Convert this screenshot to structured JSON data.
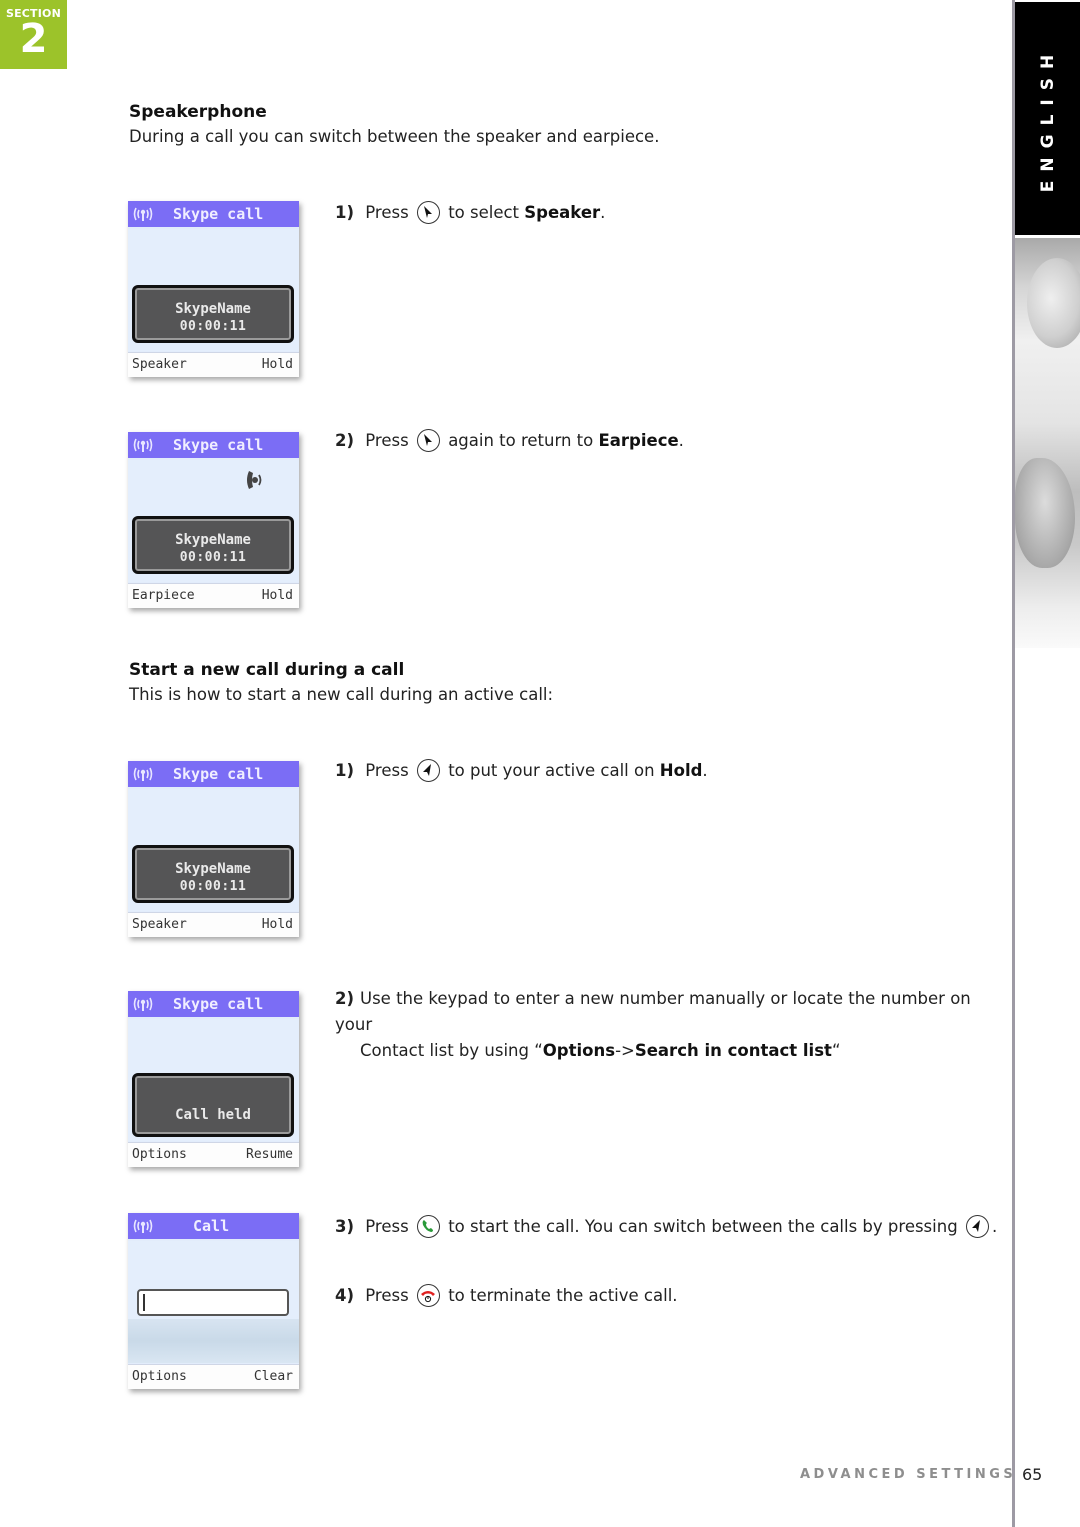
{
  "section": {
    "label": "SECTION",
    "number": "2",
    "color": "#9cc32a"
  },
  "language_tab": {
    "label": "ENGLISH"
  },
  "speakerphone": {
    "title": "Speakerphone",
    "intro": "During a call you can switch between the speaker and earpiece.",
    "steps": [
      {
        "num": "1)",
        "pre": "Press",
        "key_icon": "nav-down-right-icon",
        "post": "to select",
        "bold": "Speaker",
        "end": "."
      },
      {
        "num": "2)",
        "pre": "Press",
        "key_icon": "nav-down-right-icon",
        "post": "again to return to",
        "bold": "Earpiece",
        "end": "."
      }
    ],
    "screens": [
      {
        "title": "Skype call",
        "name": "SkypeName",
        "timer": "00:00:11",
        "left_soft": "Speaker",
        "right_soft": "Hold"
      },
      {
        "title": "Skype call",
        "name": "SkypeName",
        "timer": "00:00:11",
        "left_soft": "Earpiece",
        "right_soft": "Hold",
        "status_icon": "speaker-icon"
      }
    ]
  },
  "new_call": {
    "title": "Start a new call during a call",
    "intro": "This is how to start a new call during an active call:",
    "steps": [
      {
        "num": "1)",
        "pre": "Press",
        "key_icon": "nav-left-icon",
        "post": "to put your active call on",
        "bold": "Hold",
        "end": "."
      },
      {
        "num": "2)",
        "line1": "Use the keypad to enter a new number manually or locate the number on your",
        "line2_pre": "Contact list by using “",
        "bold1": "Options",
        "arrow": "->",
        "bold2": "Search in contact list",
        "line2_end": "“"
      },
      {
        "num": "3)",
        "pre": "Press",
        "key_icon": "call-green-icon",
        "post": "to start the call. You can switch between the calls by pressing",
        "key2_icon": "nav-left-icon",
        "end": "."
      },
      {
        "num": "4)",
        "pre": "Press",
        "key_icon": "end-call-red-icon",
        "post": "to terminate the active call."
      }
    ],
    "screens": [
      {
        "title": "Skype call",
        "name": "SkypeName",
        "timer": "00:00:11",
        "left_soft": "Speaker",
        "right_soft": "Hold"
      },
      {
        "title": "Skype call",
        "status": "Call held",
        "left_soft": "Options",
        "right_soft": "Resume"
      },
      {
        "title": "Call",
        "input_value": "",
        "left_soft": "Options",
        "right_soft": "Clear"
      }
    ]
  },
  "footer": {
    "section_name": "ADVANCED SETTINGS",
    "page_number": "65"
  },
  "colors": {
    "phone_titlebar": "#7b6df5",
    "call_green": "#2a9a3a",
    "end_red": "#e02020"
  }
}
